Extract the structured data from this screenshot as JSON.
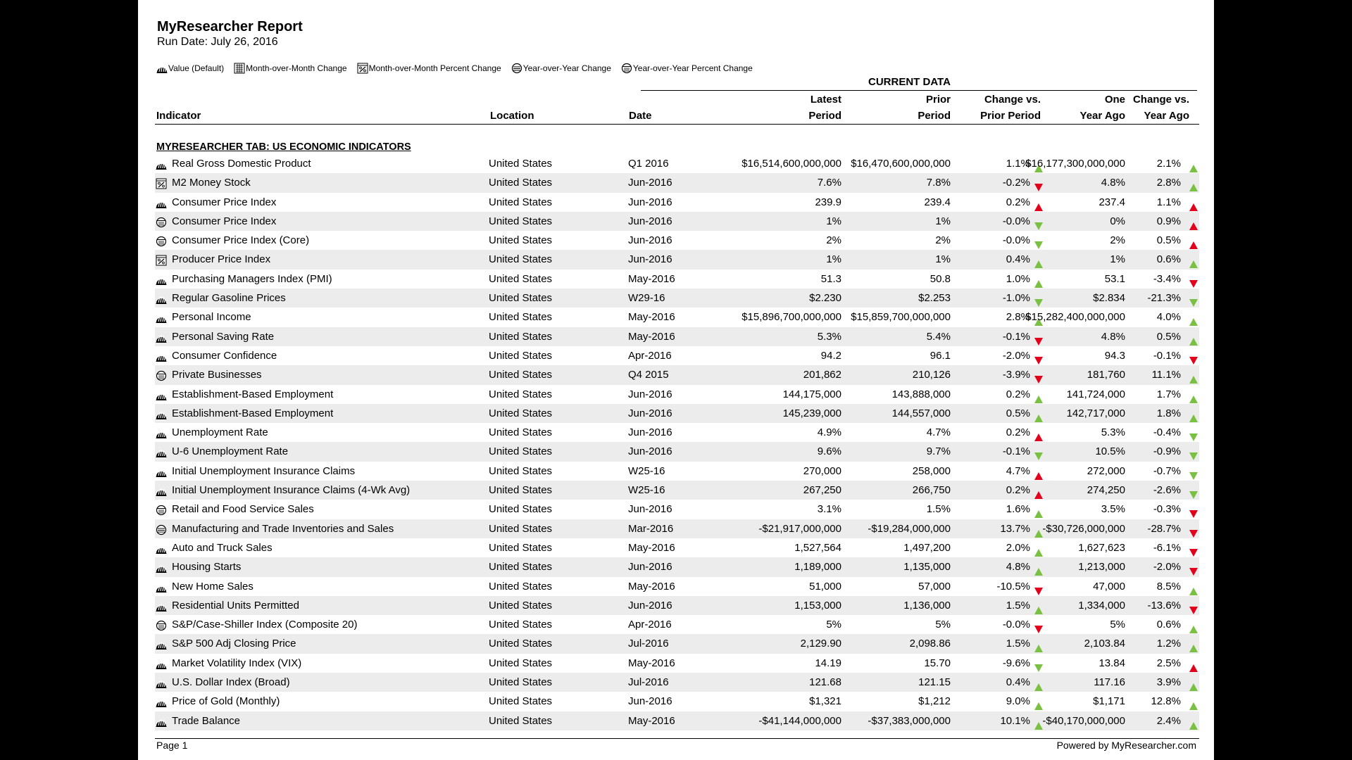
{
  "report": {
    "title": "MyResearcher Report",
    "run_date": "Run Date: July 26, 2016"
  },
  "legend": [
    {
      "icon": "value-icon",
      "label": "Value (Default)"
    },
    {
      "icon": "mom-change-icon",
      "label": "Month-over-Month Change"
    },
    {
      "icon": "mom-percent-icon",
      "label": "Month-over-Month Percent Change"
    },
    {
      "icon": "yoy-change-icon",
      "label": "Year-over-Year Change"
    },
    {
      "icon": "yoy-percent-icon",
      "label": "Year-over-Year Percent Change"
    }
  ],
  "header": {
    "group": "CURRENT DATA",
    "indicator": "Indicator",
    "location": "Location",
    "date": "Date",
    "latest_1": "Latest",
    "latest_2": "Period",
    "prior_1": "Prior",
    "prior_2": "Period",
    "chg_1": "Change vs.",
    "chg_2": "Prior Period",
    "yago_1": "One",
    "yago_2": "Year Ago",
    "chgy_1": "Change vs.",
    "chgy_2": "Year Ago"
  },
  "section": "MYRESEARCHER TAB: US ECONOMIC INDICATORS",
  "colors": {
    "up": "#7ac143",
    "down": "#e3001b",
    "up_light": "#7ac143",
    "down_light": "#7ac143"
  },
  "rows": [
    {
      "icon": "value-icon",
      "name": "Real Gross Domestic Product",
      "loc": "United States",
      "date": "Q1 2016",
      "latest": "$16,514,600,000,000",
      "prior": "$16,470,600,000,000",
      "chg": "1.1%",
      "a1": "up-green",
      "yago": "$16,177,300,000,000",
      "chgy": "2.1%",
      "a2": "up-green"
    },
    {
      "icon": "mom-percent-icon",
      "name": "M2 Money Stock",
      "loc": "United States",
      "date": "Jun-2016",
      "latest": "7.6%",
      "prior": "7.8%",
      "chg": "-0.2%",
      "a1": "down-red",
      "yago": "4.8%",
      "chgy": "2.8%",
      "a2": "up-green"
    },
    {
      "icon": "value-icon",
      "name": "Consumer Price Index",
      "loc": "United States",
      "date": "Jun-2016",
      "latest": "239.9",
      "prior": "239.4",
      "chg": "0.2%",
      "a1": "up-red",
      "yago": "237.4",
      "chgy": "1.1%",
      "a2": "up-red"
    },
    {
      "icon": "yoy-percent-icon",
      "name": "Consumer Price Index",
      "loc": "United States",
      "date": "Jun-2016",
      "latest": "1%",
      "prior": "1%",
      "chg": "-0.0%",
      "a1": "down-green",
      "yago": "0%",
      "chgy": "0.9%",
      "a2": "up-red"
    },
    {
      "icon": "yoy-percent-icon",
      "name": "Consumer Price Index (Core)",
      "loc": "United States",
      "date": "Jun-2016",
      "latest": "2%",
      "prior": "2%",
      "chg": "-0.0%",
      "a1": "down-green",
      "yago": "2%",
      "chgy": "0.5%",
      "a2": "up-red"
    },
    {
      "icon": "mom-percent-icon",
      "name": "Producer Price Index",
      "loc": "United States",
      "date": "Jun-2016",
      "latest": "1%",
      "prior": "1%",
      "chg": "0.4%",
      "a1": "up-green",
      "yago": "1%",
      "chgy": "0.6%",
      "a2": "up-green"
    },
    {
      "icon": "value-icon",
      "name": "Purchasing Managers Index (PMI)",
      "loc": "United States",
      "date": "May-2016",
      "latest": "51.3",
      "prior": "50.8",
      "chg": "1.0%",
      "a1": "up-green",
      "yago": "53.1",
      "chgy": "-3.4%",
      "a2": "down-red"
    },
    {
      "icon": "value-icon",
      "name": "Regular Gasoline Prices",
      "loc": "United States",
      "date": "W29-16",
      "latest": "$2.230",
      "prior": "$2.253",
      "chg": "-1.0%",
      "a1": "down-green",
      "yago": "$2.834",
      "chgy": "-21.3%",
      "a2": "down-green"
    },
    {
      "icon": "value-icon",
      "name": "Personal Income",
      "loc": "United States",
      "date": "May-2016",
      "latest": "$15,896,700,000,000",
      "prior": "$15,859,700,000,000",
      "chg": "2.8%",
      "a1": "up-green",
      "yago": "$15,282,400,000,000",
      "chgy": "4.0%",
      "a2": "up-green"
    },
    {
      "icon": "value-icon",
      "name": "Personal Saving Rate",
      "loc": "United States",
      "date": "May-2016",
      "latest": "5.3%",
      "prior": "5.4%",
      "chg": "-0.1%",
      "a1": "down-red",
      "yago": "4.8%",
      "chgy": "0.5%",
      "a2": "up-green"
    },
    {
      "icon": "value-icon",
      "name": "Consumer Confidence",
      "loc": "United States",
      "date": "Apr-2016",
      "latest": "94.2",
      "prior": "96.1",
      "chg": "-2.0%",
      "a1": "down-red",
      "yago": "94.3",
      "chgy": "-0.1%",
      "a2": "down-red"
    },
    {
      "icon": "yoy-percent-icon",
      "name": "Private Businesses",
      "loc": "United States",
      "date": "Q4 2015",
      "latest": "201,862",
      "prior": "210,126",
      "chg": "-3.9%",
      "a1": "down-red",
      "yago": "181,760",
      "chgy": "11.1%",
      "a2": "up-green"
    },
    {
      "icon": "value-icon",
      "name": "Establishment-Based Employment",
      "loc": "United States",
      "date": "Jun-2016",
      "latest": "144,175,000",
      "prior": "143,888,000",
      "chg": "0.2%",
      "a1": "up-green",
      "yago": "141,724,000",
      "chgy": "1.7%",
      "a2": "up-green"
    },
    {
      "icon": "value-icon",
      "name": "Establishment-Based Employment",
      "loc": "United States",
      "date": "Jun-2016",
      "latest": "145,239,000",
      "prior": "144,557,000",
      "chg": "0.5%",
      "a1": "up-green",
      "yago": "142,717,000",
      "chgy": "1.8%",
      "a2": "up-green"
    },
    {
      "icon": "value-icon",
      "name": "Unemployment Rate",
      "loc": "United States",
      "date": "Jun-2016",
      "latest": "4.9%",
      "prior": "4.7%",
      "chg": "0.2%",
      "a1": "up-red",
      "yago": "5.3%",
      "chgy": "-0.4%",
      "a2": "down-green"
    },
    {
      "icon": "value-icon",
      "name": "U-6 Unemployment Rate",
      "loc": "United States",
      "date": "Jun-2016",
      "latest": "9.6%",
      "prior": "9.7%",
      "chg": "-0.1%",
      "a1": "down-green",
      "yago": "10.5%",
      "chgy": "-0.9%",
      "a2": "down-green"
    },
    {
      "icon": "value-icon",
      "name": "Initial Unemployment Insurance Claims",
      "loc": "United States",
      "date": "W25-16",
      "latest": "270,000",
      "prior": "258,000",
      "chg": "4.7%",
      "a1": "up-red",
      "yago": "272,000",
      "chgy": "-0.7%",
      "a2": "down-green"
    },
    {
      "icon": "value-icon",
      "name": "Initial Unemployment Insurance Claims (4-Wk Avg)",
      "loc": "United States",
      "date": "W25-16",
      "latest": "267,250",
      "prior": "266,750",
      "chg": "0.2%",
      "a1": "up-red",
      "yago": "274,250",
      "chgy": "-2.6%",
      "a2": "down-green"
    },
    {
      "icon": "yoy-percent-icon",
      "name": "Retail and Food Service Sales",
      "loc": "United States",
      "date": "Jun-2016",
      "latest": "3.1%",
      "prior": "1.5%",
      "chg": "1.6%",
      "a1": "up-green",
      "yago": "3.5%",
      "chgy": "-0.3%",
      "a2": "down-red"
    },
    {
      "icon": "yoy-change-icon",
      "name": "Manufacturing and Trade Inventories and Sales",
      "loc": "United States",
      "date": "Mar-2016",
      "latest": "-$21,917,000,000",
      "prior": "-$19,284,000,000",
      "chg": "13.7%",
      "a1": "up-green",
      "yago": "-$30,726,000,000",
      "chgy": "-28.7%",
      "a2": "down-red"
    },
    {
      "icon": "value-icon",
      "name": "Auto and Truck Sales",
      "loc": "United States",
      "date": "May-2016",
      "latest": "1,527,564",
      "prior": "1,497,200",
      "chg": "2.0%",
      "a1": "up-green",
      "yago": "1,627,623",
      "chgy": "-6.1%",
      "a2": "down-red"
    },
    {
      "icon": "value-icon",
      "name": "Housing Starts",
      "loc": "United States",
      "date": "Jun-2016",
      "latest": "1,189,000",
      "prior": "1,135,000",
      "chg": "4.8%",
      "a1": "up-green",
      "yago": "1,213,000",
      "chgy": "-2.0%",
      "a2": "down-red"
    },
    {
      "icon": "value-icon",
      "name": "New Home Sales",
      "loc": "United States",
      "date": "May-2016",
      "latest": "51,000",
      "prior": "57,000",
      "chg": "-10.5%",
      "a1": "down-red",
      "yago": "47,000",
      "chgy": "8.5%",
      "a2": "up-green"
    },
    {
      "icon": "value-icon",
      "name": "Residential Units Permitted",
      "loc": "United States",
      "date": "Jun-2016",
      "latest": "1,153,000",
      "prior": "1,136,000",
      "chg": "1.5%",
      "a1": "up-green",
      "yago": "1,334,000",
      "chgy": "-13.6%",
      "a2": "down-red"
    },
    {
      "icon": "yoy-percent-icon",
      "name": "S&P/Case-Shiller Index (Composite 20)",
      "loc": "United States",
      "date": "Apr-2016",
      "latest": "5%",
      "prior": "5%",
      "chg": "-0.0%",
      "a1": "down-red",
      "yago": "5%",
      "chgy": "0.6%",
      "a2": "up-green"
    },
    {
      "icon": "value-icon",
      "name": "S&P 500 Adj Closing Price",
      "loc": "United States",
      "date": "Jul-2016",
      "latest": "2,129.90",
      "prior": "2,098.86",
      "chg": "1.5%",
      "a1": "up-green",
      "yago": "2,103.84",
      "chgy": "1.2%",
      "a2": "up-green"
    },
    {
      "icon": "value-icon",
      "name": "Market Volatility Index (VIX)",
      "loc": "United States",
      "date": "May-2016",
      "latest": "14.19",
      "prior": "15.70",
      "chg": "-9.6%",
      "a1": "down-green",
      "yago": "13.84",
      "chgy": "2.5%",
      "a2": "up-red"
    },
    {
      "icon": "value-icon",
      "name": "U.S. Dollar Index (Broad)",
      "loc": "United States",
      "date": "Jul-2016",
      "latest": "121.68",
      "prior": "121.15",
      "chg": "0.4%",
      "a1": "up-green",
      "yago": "117.16",
      "chgy": "3.9%",
      "a2": "up-green"
    },
    {
      "icon": "value-icon",
      "name": "Price of Gold (Monthly)",
      "loc": "United States",
      "date": "Jun-2016",
      "latest": "$1,321",
      "prior": "$1,212",
      "chg": "9.0%",
      "a1": "up-green",
      "yago": "$1,171",
      "chgy": "12.8%",
      "a2": "up-green"
    },
    {
      "icon": "value-icon",
      "name": "Trade Balance",
      "loc": "United States",
      "date": "May-2016",
      "latest": "-$41,144,000,000",
      "prior": "-$37,383,000,000",
      "chg": "10.1%",
      "a1": "up-green",
      "yago": "-$40,170,000,000",
      "chgy": "2.4%",
      "a2": "up-green"
    }
  ],
  "footer": {
    "page": "Page 1",
    "powered": "Powered by MyResearcher.com"
  }
}
